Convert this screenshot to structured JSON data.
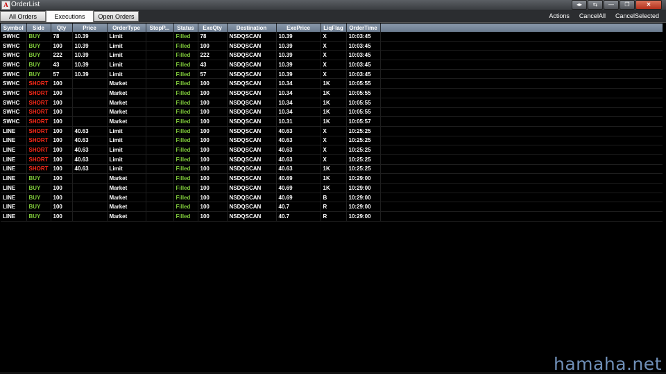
{
  "window": {
    "title": "OrderList",
    "icon": "A",
    "controls": [
      "◂▸",
      "⇆",
      "—",
      "❐",
      "✕"
    ]
  },
  "tabs": [
    {
      "label": "All Orders",
      "active": false
    },
    {
      "label": "Executions",
      "active": true
    },
    {
      "label": "Open Orders",
      "active": false
    }
  ],
  "actions": [
    "Actions",
    "CancelAll",
    "CancelSelected"
  ],
  "table": {
    "columns": [
      "Symbol",
      "Side",
      "Qty",
      "Price",
      "OrderType",
      "StopP...",
      "Status",
      "ExeQty",
      "Destination",
      "ExePrice",
      "LiqFlag",
      "OrderTime"
    ],
    "rows": [
      [
        "SWHC",
        "BUY",
        "78",
        "10.39",
        "Limit",
        "",
        "Filled",
        "78",
        "NSDQSCAN",
        "10.39",
        "X",
        "10:03:45"
      ],
      [
        "SWHC",
        "BUY",
        "100",
        "10.39",
        "Limit",
        "",
        "Filled",
        "100",
        "NSDQSCAN",
        "10.39",
        "X",
        "10:03:45"
      ],
      [
        "SWHC",
        "BUY",
        "222",
        "10.39",
        "Limit",
        "",
        "Filled",
        "222",
        "NSDQSCAN",
        "10.39",
        "X",
        "10:03:45"
      ],
      [
        "SWHC",
        "BUY",
        "43",
        "10.39",
        "Limit",
        "",
        "Filled",
        "43",
        "NSDQSCAN",
        "10.39",
        "X",
        "10:03:45"
      ],
      [
        "SWHC",
        "BUY",
        "57",
        "10.39",
        "Limit",
        "",
        "Filled",
        "57",
        "NSDQSCAN",
        "10.39",
        "X",
        "10:03:45"
      ],
      [
        "SWHC",
        "SHORT",
        "100",
        "",
        "Market",
        "",
        "Filled",
        "100",
        "NSDQSCAN",
        "10.34",
        "1K",
        "10:05:55"
      ],
      [
        "SWHC",
        "SHORT",
        "100",
        "",
        "Market",
        "",
        "Filled",
        "100",
        "NSDQSCAN",
        "10.34",
        "1K",
        "10:05:55"
      ],
      [
        "SWHC",
        "SHORT",
        "100",
        "",
        "Market",
        "",
        "Filled",
        "100",
        "NSDQSCAN",
        "10.34",
        "1K",
        "10:05:55"
      ],
      [
        "SWHC",
        "SHORT",
        "100",
        "",
        "Market",
        "",
        "Filled",
        "100",
        "NSDQSCAN",
        "10.34",
        "1K",
        "10:05:55"
      ],
      [
        "SWHC",
        "SHORT",
        "100",
        "",
        "Market",
        "",
        "Filled",
        "100",
        "NSDQSCAN",
        "10.31",
        "1K",
        "10:05:57"
      ],
      [
        "LINE",
        "SHORT",
        "100",
        "40.63",
        "Limit",
        "",
        "Filled",
        "100",
        "NSDQSCAN",
        "40.63",
        "X",
        "10:25:25"
      ],
      [
        "LINE",
        "SHORT",
        "100",
        "40.63",
        "Limit",
        "",
        "Filled",
        "100",
        "NSDQSCAN",
        "40.63",
        "X",
        "10:25:25"
      ],
      [
        "LINE",
        "SHORT",
        "100",
        "40.63",
        "Limit",
        "",
        "Filled",
        "100",
        "NSDQSCAN",
        "40.63",
        "X",
        "10:25:25"
      ],
      [
        "LINE",
        "SHORT",
        "100",
        "40.63",
        "Limit",
        "",
        "Filled",
        "100",
        "NSDQSCAN",
        "40.63",
        "X",
        "10:25:25"
      ],
      [
        "LINE",
        "SHORT",
        "100",
        "40.63",
        "Limit",
        "",
        "Filled",
        "100",
        "NSDQSCAN",
        "40.63",
        "1K",
        "10:25:25"
      ],
      [
        "LINE",
        "BUY",
        "100",
        "",
        "Market",
        "",
        "Filled",
        "100",
        "NSDQSCAN",
        "40.69",
        "1K",
        "10:29:00"
      ],
      [
        "LINE",
        "BUY",
        "100",
        "",
        "Market",
        "",
        "Filled",
        "100",
        "NSDQSCAN",
        "40.69",
        "1K",
        "10:29:00"
      ],
      [
        "LINE",
        "BUY",
        "100",
        "",
        "Market",
        "",
        "Filled",
        "100",
        "NSDQSCAN",
        "40.69",
        "B",
        "10:29:00"
      ],
      [
        "LINE",
        "BUY",
        "100",
        "",
        "Market",
        "",
        "Filled",
        "100",
        "NSDQSCAN",
        "40.7",
        "R",
        "10:29:00"
      ],
      [
        "LINE",
        "BUY",
        "100",
        "",
        "Market",
        "",
        "Filled",
        "100",
        "NSDQSCAN",
        "40.7",
        "R",
        "10:29:00"
      ]
    ]
  },
  "watermark": "hamaha.net",
  "colors": {
    "buy": "#7ec83a",
    "short": "#ff2a1a",
    "filled": "#7ec83a",
    "header": "#7a8a9e",
    "background": "#000000"
  }
}
